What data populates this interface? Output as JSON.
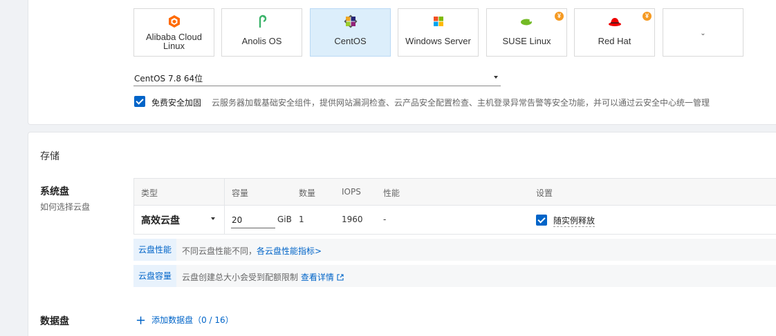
{
  "os_tiles": [
    {
      "label": "Alibaba Cloud Linux",
      "icon": "alibaba-cloud-icon",
      "selected": false,
      "paid": false
    },
    {
      "label": "Anolis OS",
      "icon": "anolis-icon",
      "selected": false,
      "paid": false
    },
    {
      "label": "CentOS",
      "icon": "centos-icon",
      "selected": true,
      "paid": false
    },
    {
      "label": "Windows Server",
      "icon": "windows-icon",
      "selected": false,
      "paid": false
    },
    {
      "label": "SUSE Linux",
      "icon": "suse-icon",
      "selected": false,
      "paid": true
    },
    {
      "label": "Red Hat",
      "icon": "redhat-icon",
      "selected": false,
      "paid": true
    }
  ],
  "fee_badge": "¥",
  "more_chevron": "⌄",
  "version_value": "CentOS 7.8 64位",
  "security": {
    "label": "免费安全加固",
    "description": "云服务器加载基础安全组件，提供网站漏洞检查、云产品安全配置检查、主机登录异常告警等安全功能，并可以通过云安全中心统一管理",
    "checked": true
  },
  "storage": {
    "title": "存储",
    "system_disk": {
      "title": "系统盘",
      "help": "如何选择云盘",
      "headers": {
        "type": "类型",
        "capacity": "容量",
        "count": "数量",
        "iops": "IOPS",
        "performance": "性能",
        "settings": "设置"
      },
      "type_value": "高效云盘",
      "size_value": "20",
      "size_unit": "GiB",
      "count_value": "1",
      "iops_value": "1960",
      "performance_value": "-",
      "release_label": "随实例释放",
      "release_checked": true
    },
    "perf_bar": {
      "tag": "云盘性能",
      "text": "不同云盘性能不同，",
      "link": "各云盘性能指标>"
    },
    "cap_bar": {
      "tag": "云盘容量",
      "text": "云盘创建总大小会受到配额限制",
      "link": "查看详情"
    },
    "data_disk": {
      "title": "数据盘",
      "add_label": "添加数据盘（0 / 16）"
    }
  },
  "colors": {
    "accent": "#0064c8",
    "selected_bg": "#dceefb",
    "fee": "#f59a23"
  }
}
